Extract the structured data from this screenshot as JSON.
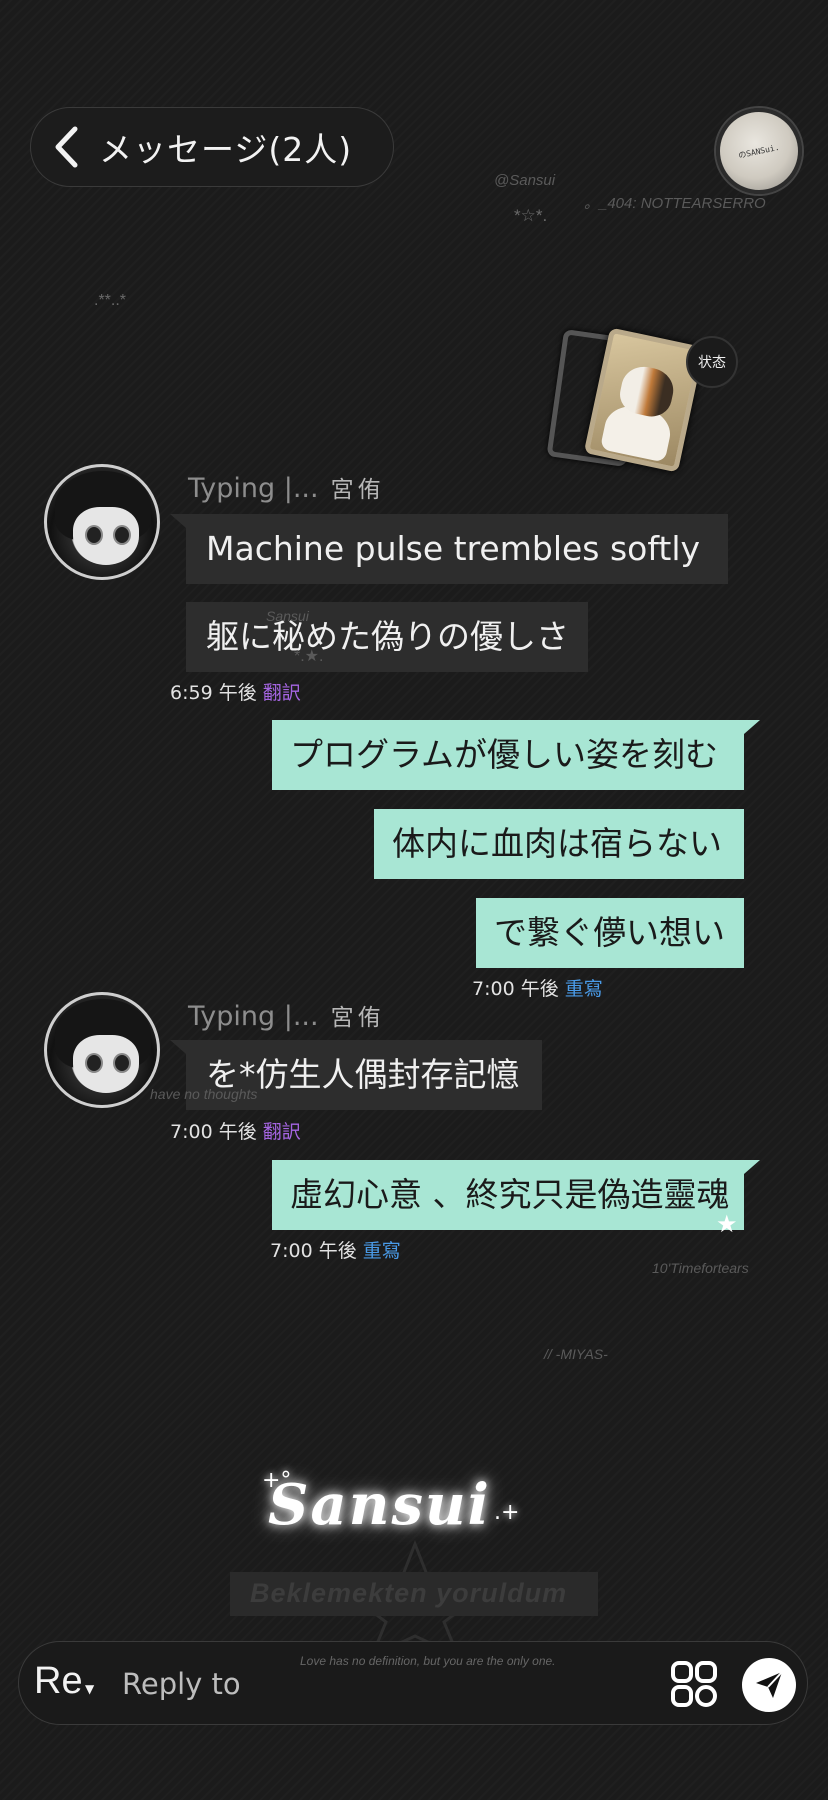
{
  "header": {
    "title": "メッセージ(2人)",
    "avatar_text": "のSANSui."
  },
  "decorations": {
    "watermark_1": "@Sansui",
    "watermark_2": "。_404:  NOTTEARSERRO",
    "stars_1": "*☆*.",
    "stars_2": ".**..*",
    "mid_text": "Sansui",
    "mid_stars": "*.★.",
    "have_no_thoughts": "have no thoughts",
    "timefortears": "10'Timefortears",
    "miyas": "//    -MIYAS-",
    "signature": "Sansui",
    "sig_left": "+°",
    "sig_right": ".+",
    "bekle": "Beklemekten yoruldum",
    "love": "Love has no definition, but you are the only one."
  },
  "story": {
    "status_label": "状态"
  },
  "messages": {
    "group1": {
      "typing": "Typing |...",
      "name": "宮侑",
      "msg1": "Machine pulse trembles softly",
      "msg2": "躯に秘めた偽りの優しさ",
      "time": "6:59 午後",
      "action": "翻訳"
    },
    "group2": {
      "msg1": "プログラムが優しい姿を刻む",
      "msg2": "体内に血肉は宿らない",
      "msg3": "で繋ぐ儚い想い",
      "time": "7:00 午後",
      "action": "重寫"
    },
    "group3": {
      "typing": "Typing |...",
      "name": "宮侑",
      "msg1": "を*仿生人偶封存記憶",
      "time": "7:00 午後",
      "action": "翻訳"
    },
    "group4": {
      "msg1": "虛幻心意 、終究只是偽造靈魂",
      "time": "7:00 午後",
      "action": "重寫"
    }
  },
  "composer": {
    "re_label": "Re",
    "placeholder": "Reply to"
  },
  "icons": {
    "back": "chevron-left-icon",
    "apps": "apps-grid-icon",
    "send": "send-icon"
  }
}
